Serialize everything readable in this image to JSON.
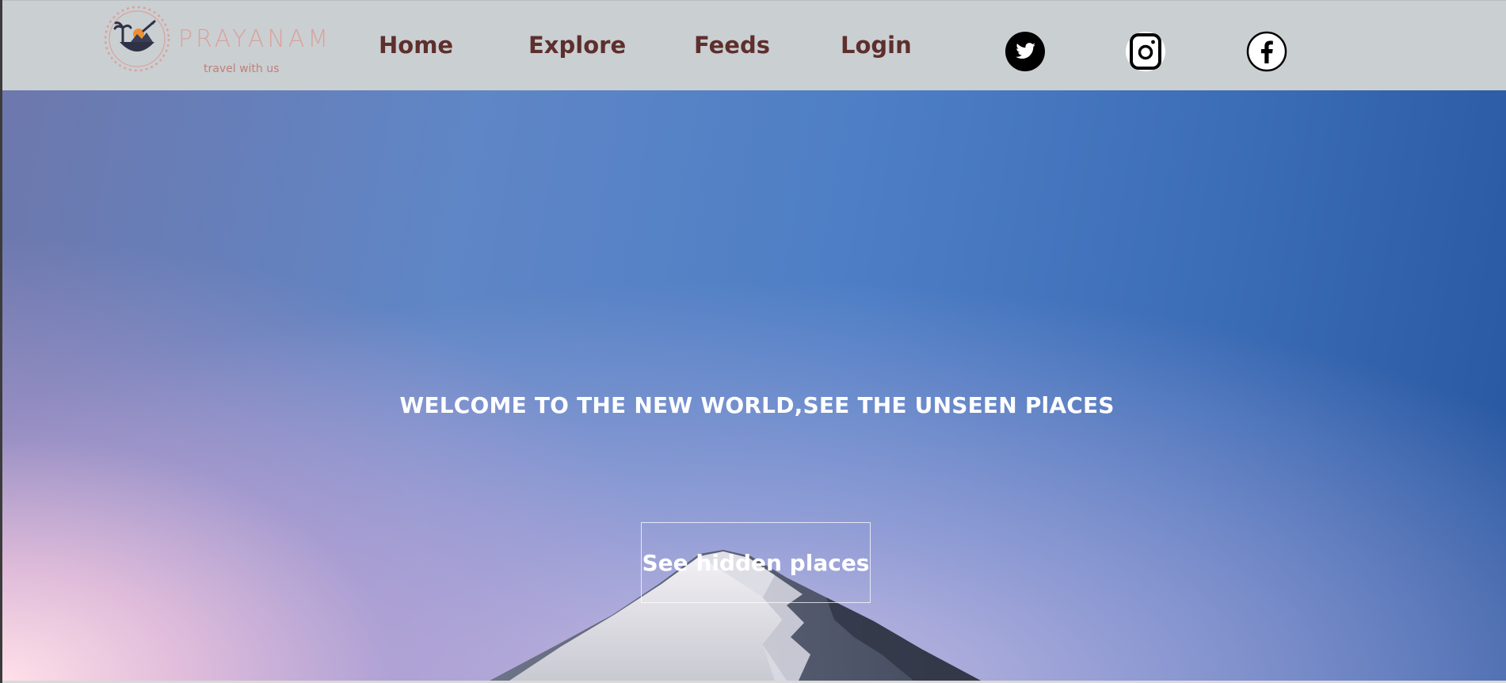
{
  "brand": {
    "name": "PRAYANAM",
    "tagline": "travel with us"
  },
  "nav": {
    "items": [
      {
        "label": "Home"
      },
      {
        "label": "Explore"
      },
      {
        "label": "Feeds"
      },
      {
        "label": "Login"
      }
    ]
  },
  "social": {
    "icons": [
      "twitter-icon",
      "instagram-icon",
      "facebook-icon"
    ]
  },
  "hero": {
    "title": "WELCOME TO THE NEW WORLD,SEE THE UNSEEN PlACES",
    "button_label": "See hidden places"
  },
  "colors": {
    "header_bg": "#cacfd2",
    "nav_text": "#5e2f2c",
    "logo_accent": "#d9a39c",
    "hero_text": "#ffffff"
  }
}
